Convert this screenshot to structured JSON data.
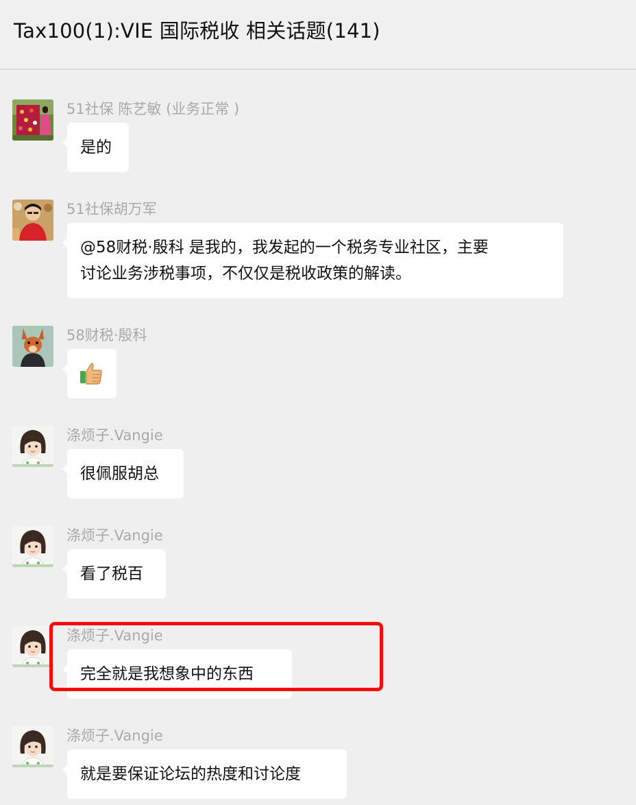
{
  "header": {
    "title": "Tax100(1):VIE 国际税收 相关话题(141)"
  },
  "messages": [
    {
      "sender": "51社保 陈艺敏 (业务正常 )",
      "avatar": "photo-avatar-red-quilt",
      "text": "是的"
    },
    {
      "sender": "51社保胡万军",
      "avatar": "photo-avatar-man-red-shirt",
      "lines": [
        "@58财税·殷科 是我的，我发起的一个税务专业社区，主要",
        "讨论业务涉税事项，不仅仅是税收政策的解读。"
      ]
    },
    {
      "sender": "58财税·殷科",
      "avatar": "squirrel-avatar",
      "emoji": "👍",
      "emoji_name": "thumbs-up-emoji"
    },
    {
      "sender": "涤烦子.Vangie",
      "avatar": "cartoon-woman-avatar",
      "text": "很佩服胡总"
    },
    {
      "sender": "涤烦子.Vangie",
      "avatar": "cartoon-woman-avatar",
      "text": "看了税百"
    },
    {
      "sender": "涤烦子.Vangie",
      "avatar": "cartoon-woman-avatar",
      "text": "完全就是我想象中的东西"
    },
    {
      "sender": "涤烦子.Vangie",
      "avatar": "cartoon-woman-avatar",
      "text": "就是要保证论坛的热度和讨论度"
    }
  ],
  "colors": {
    "background": "#efefef",
    "bubble": "#ffffff",
    "sender_name": "#a9a9a9",
    "highlight": "#f40d0d"
  }
}
